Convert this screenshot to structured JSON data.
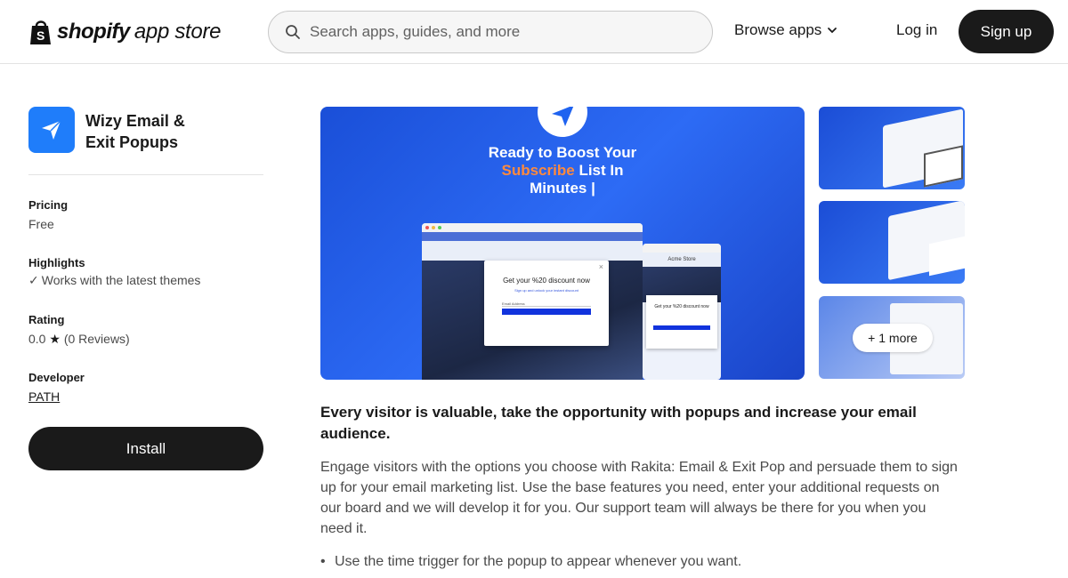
{
  "header": {
    "logo_word": "shopify",
    "logo_sub": "app store",
    "search_placeholder": "Search apps, guides, and more",
    "browse_label": "Browse apps",
    "login_label": "Log in",
    "signup_label": "Sign up"
  },
  "app": {
    "name_line1": "Wizy Email &",
    "name_line2": "Exit Popups",
    "icon": "paper-plane-icon",
    "icon_color": "#1f7dfa"
  },
  "meta": {
    "pricing_label": "Pricing",
    "pricing_value": "Free",
    "highlights_label": "Highlights",
    "highlights_value": "Works with the latest themes",
    "rating_label": "Rating",
    "rating_value": "0.0",
    "rating_reviews": "(0 Reviews)",
    "developer_label": "Developer",
    "developer_value": "PATH"
  },
  "install_label": "Install",
  "media": {
    "hero_line1": "Ready to Boost Your",
    "hero_line2a": "Subscribe",
    "hero_line2b": "List In",
    "hero_line3": "Minutes |",
    "popup_title": "Get your %20 discount now",
    "popup_sub": "Sign up and unlock your instant discount",
    "popup_email": "Email Address",
    "mobile_store": "Acme Store",
    "more_label": "+ 1 more"
  },
  "description": {
    "heading": "Every visitor is valuable, take the opportunity with popups and increase your email audience.",
    "body": "Engage visitors with the options you choose with Rakita: Email & Exit Pop and persuade them to sign up for your email marketing list. Use the base features you need, enter your additional requests on our board and we will develop it for you. Our support team will always be there for you when you need it.",
    "bullet1": "Use the time trigger for the popup to appear whenever you want."
  }
}
